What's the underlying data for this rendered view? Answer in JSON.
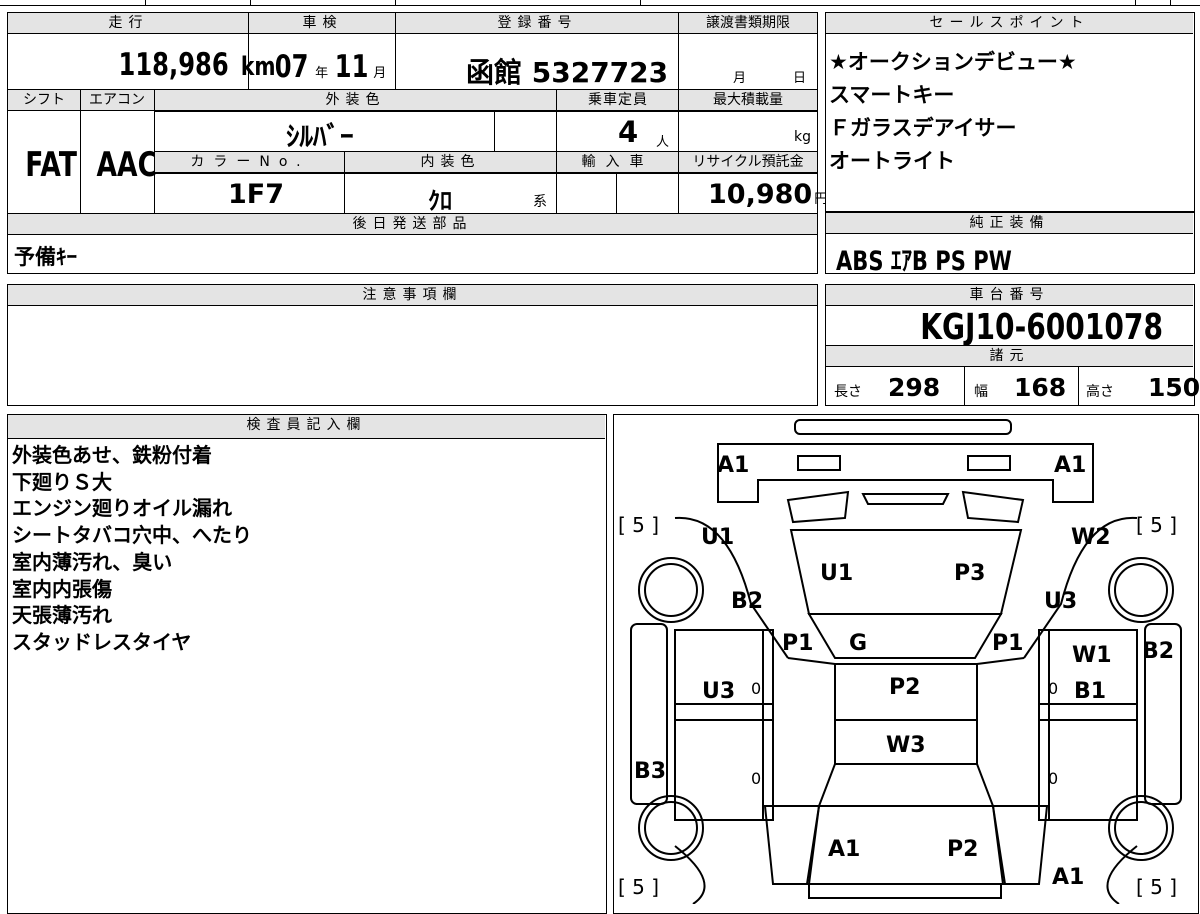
{
  "top_strip": [
    "",
    "",
    "",
    ""
  ],
  "mileage": {
    "header": "走行",
    "value": "118,986",
    "unit": "km"
  },
  "inspection": {
    "header": "車検",
    "year": "07",
    "year_unit": "年",
    "month": "11",
    "month_unit": "月"
  },
  "registration": {
    "header": "登録番号",
    "value": "函館 5327723"
  },
  "transfer_deadline": {
    "header": "譲渡書類期限",
    "month_unit": "月",
    "day_unit": "日"
  },
  "shift": {
    "header": "シフト",
    "value": "FAT"
  },
  "aircon": {
    "header": "エアコン",
    "value": "AAC"
  },
  "exterior_color": {
    "header": "外装色",
    "value": "ｼﾙﾊﾞｰ"
  },
  "capacity": {
    "header": "乗車定員",
    "value": "4",
    "unit": "人"
  },
  "max_load": {
    "header": "最大積載量",
    "unit": "kg"
  },
  "color_no": {
    "header": "カラーNo.",
    "value": "1F7"
  },
  "interior_color": {
    "header": "内装色",
    "value": "ｸﾛ",
    "unit": "系"
  },
  "import": {
    "header": "輸入車"
  },
  "recycle_fee": {
    "header": "リサイクル預託金",
    "value": "10,980",
    "unit": "円"
  },
  "later_parts": {
    "header": "後日発送部品",
    "value": "予備ｷｰ"
  },
  "sales_points": {
    "header": "セールスポイント",
    "items": [
      "★オークションデビュー★",
      "スマートキー",
      "Ｆガラスデアイサー",
      "オートライト"
    ]
  },
  "genuine_equipment": {
    "header": "純正装備",
    "value": "ABS ｴｱB PS PW"
  },
  "notes": {
    "header": "注意事項欄"
  },
  "chassis": {
    "header": "車台番号",
    "value": "KGJ10-6001078"
  },
  "specs": {
    "header": "諸元",
    "length_label": "長さ",
    "length": "298",
    "width_label": "幅",
    "width": "168",
    "height_label": "高さ",
    "height": "150"
  },
  "inspector": {
    "header": "検査員記入欄",
    "items": [
      "外装色あせ、鉄粉付着",
      "下廻りＳ大",
      "エンジン廻りオイル漏れ",
      "シートタバコ穴中、へたり",
      "室内薄汚れ、臭い",
      "室内内張傷",
      "天張薄汚れ",
      "スタッドレスタイヤ"
    ]
  },
  "diagram": {
    "tire_depth": [
      "[ 5 ]",
      "[ 5 ]",
      "[ 5 ]",
      "[ 5 ]"
    ],
    "labels": {
      "a1_front_left": "A1",
      "a1_front_right": "A1",
      "u1_left": "U1",
      "w2_right": "W2",
      "u1_hood": "U1",
      "p3_hood": "P3",
      "b2_left": "B2",
      "u3_right": "U3",
      "p1_left": "P1",
      "g_windshield": "G",
      "p1_right": "P1",
      "w1_right": "W1",
      "b2_far_right": "B2",
      "u3_left": "U3",
      "b1_right": "B1",
      "p2_roof": "P2",
      "w3_roof": "W3",
      "b3_left": "B3",
      "a1_rear": "A1",
      "p2_rear": "P2",
      "a1_rear_right": "A1"
    },
    "zeros": [
      "0",
      "0",
      "0",
      "0"
    ]
  }
}
